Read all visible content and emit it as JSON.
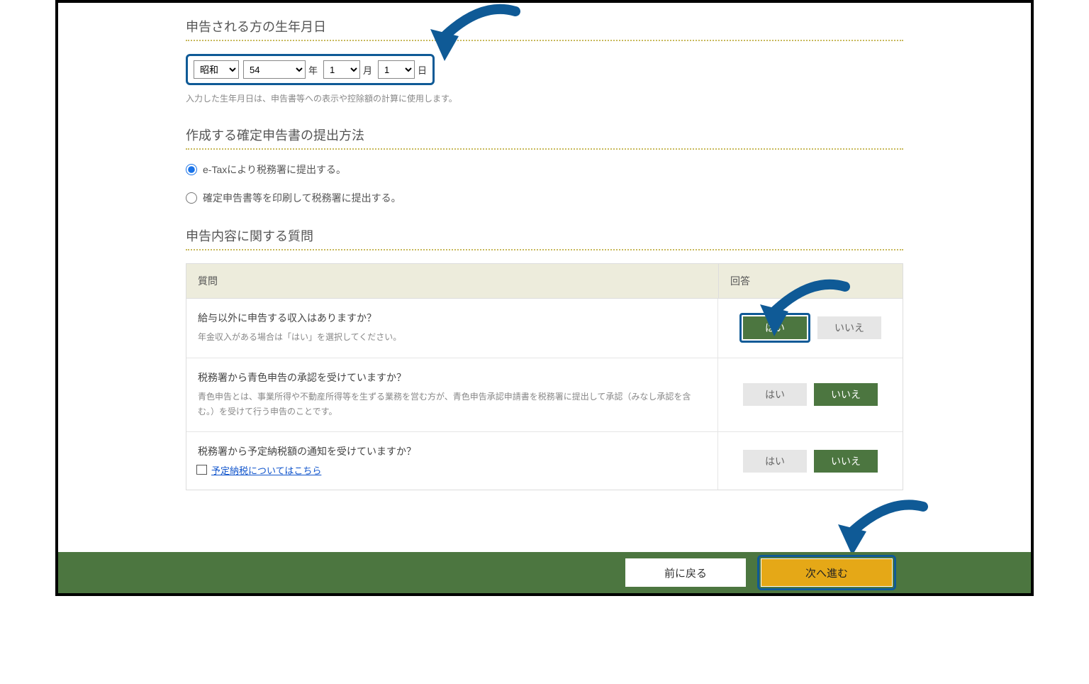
{
  "sections": {
    "dob": {
      "title": "申告される方の生年月日",
      "era": "昭和",
      "year": "54",
      "month": "1",
      "day": "1",
      "unit_year": "年",
      "unit_month": "月",
      "unit_day": "日",
      "note": "入力した生年月日は、申告書等への表示や控除額の計算に使用します。"
    },
    "submission": {
      "title": "作成する確定申告書の提出方法",
      "option_etax": "e-Taxにより税務署に提出する。",
      "option_print": "確定申告書等を印刷して税務署に提出する。"
    },
    "questions": {
      "title": "申告内容に関する質問",
      "header_q": "質問",
      "header_a": "回答",
      "yes": "はい",
      "no": "いいえ",
      "rows": [
        {
          "q": "給与以外に申告する収入はありますか？",
          "sub": "年金収入がある場合は「はい」を選択してください。",
          "answer": "yes",
          "highlight": true
        },
        {
          "q": "税務署から青色申告の承認を受けていますか？",
          "sub": "青色申告とは、事業所得や不動産所得等を生ずる業務を営む方が、青色申告承認申請書を税務署に提出して承認（みなし承認を含む。）を受けて行う申告のことです。",
          "answer": "no",
          "highlight": false
        },
        {
          "q": "税務署から予定納税額の通知を受けていますか？",
          "link": "予定納税についてはこちら",
          "answer": "no",
          "highlight": false
        }
      ]
    }
  },
  "footer": {
    "back": "前に戻る",
    "next": "次へ進む"
  }
}
